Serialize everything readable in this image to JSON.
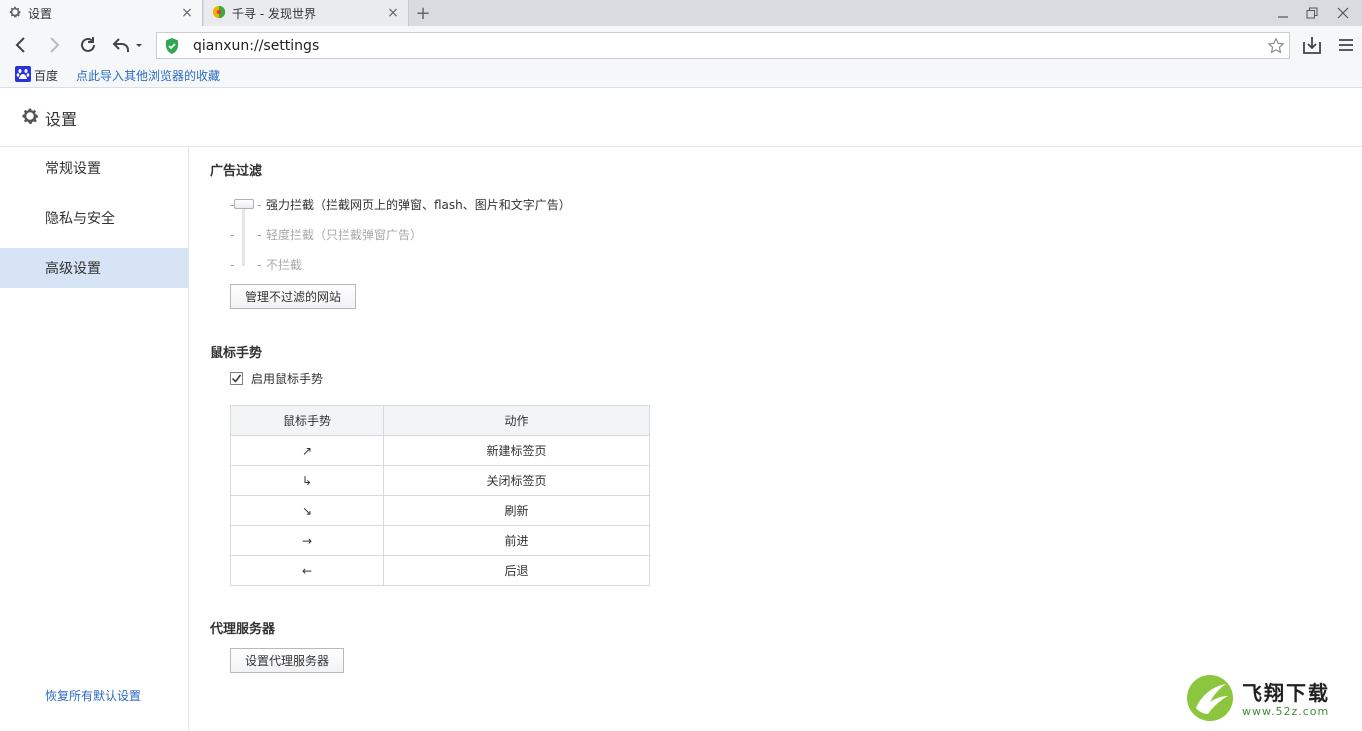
{
  "tabs": [
    {
      "title": "设置",
      "icon": "gear-icon",
      "active": true
    },
    {
      "title": "千寻 - 发现世界",
      "icon": "qianxun-logo-icon",
      "active": false
    }
  ],
  "new_tab": "+",
  "window_controls": [
    "minimize-icon",
    "restore-icon",
    "close-icon"
  ],
  "toolbar": {
    "url": "qianxun://settings",
    "icons": [
      "back-icon",
      "forward-icon",
      "reload-icon",
      "undo-icon",
      "shield-icon",
      "star-icon",
      "download-icon",
      "menu-icon"
    ]
  },
  "bookmarks": {
    "baidu": "百度",
    "import_link": "点此导入其他浏览器的收藏"
  },
  "header": {
    "title": "设置"
  },
  "sidebar": {
    "items": [
      {
        "label": "常规设置",
        "selected": false
      },
      {
        "label": "隐私与安全",
        "selected": false
      },
      {
        "label": "高级设置",
        "selected": true
      }
    ],
    "restore_link": "恢复所有默认设置"
  },
  "ad_filter": {
    "title": "广告过滤",
    "options": [
      {
        "label": "强力拦截（拦截网页上的弹窗、flash、图片和文字广告）",
        "selected": true
      },
      {
        "label": "轻度拦截（只拦截弹窗广告）",
        "selected": false
      },
      {
        "label": "不拦截",
        "selected": false
      }
    ],
    "manage_button": "管理不过滤的网站"
  },
  "mouse_gesture": {
    "title": "鼠标手势",
    "enable_label": "启用鼠标手势",
    "enabled": true,
    "table": {
      "headers": [
        "鼠标手势",
        "动作"
      ],
      "rows": [
        {
          "gesture": "↗",
          "action": "新建标签页"
        },
        {
          "gesture": "↳",
          "action": "关闭标签页"
        },
        {
          "gesture": "↘",
          "action": "刷新"
        },
        {
          "gesture": "→",
          "action": "前进"
        },
        {
          "gesture": "←",
          "action": "后退"
        }
      ]
    }
  },
  "proxy": {
    "title": "代理服务器",
    "button": "设置代理服务器"
  },
  "watermark": {
    "name": "飞翔下载",
    "url": "www.52z.com"
  }
}
